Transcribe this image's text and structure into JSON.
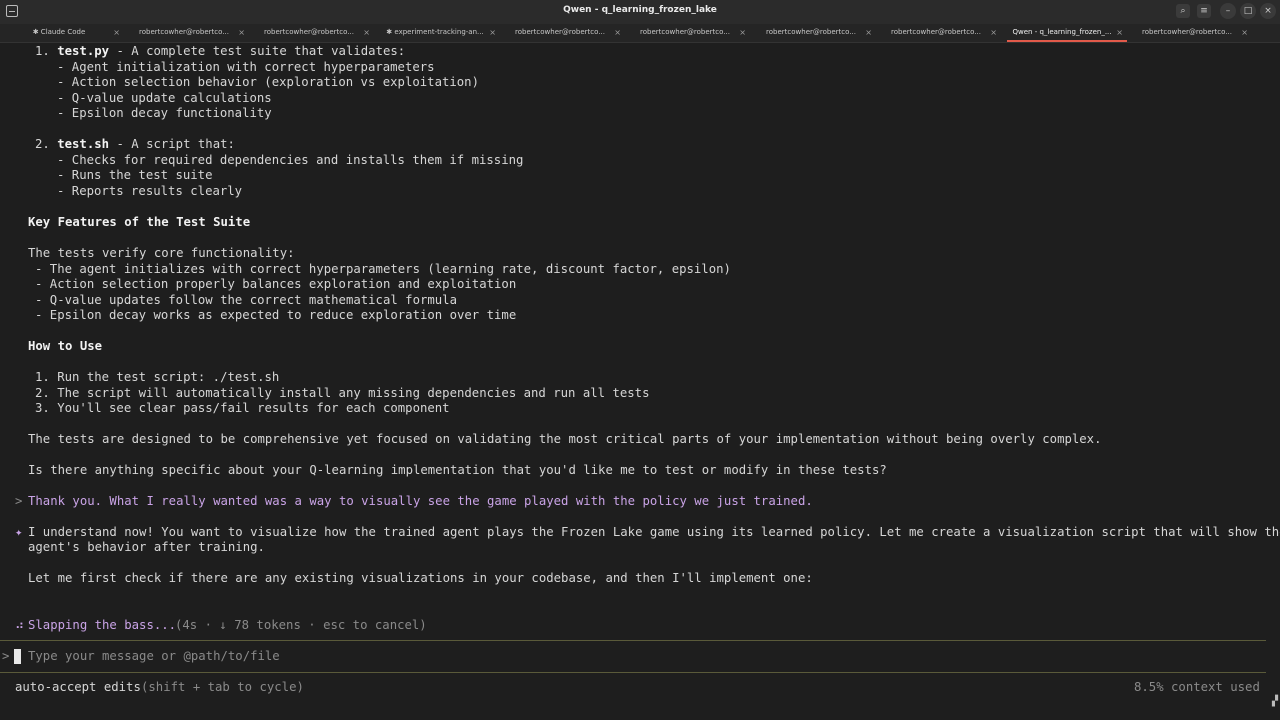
{
  "window": {
    "title": "Qwen - q_learning_frozen_lake"
  },
  "tabs": [
    {
      "label": "✱ Claude Code",
      "active": false
    },
    {
      "label": "robertcowher@robertco...",
      "active": false
    },
    {
      "label": "robertcowher@robertco...",
      "active": false
    },
    {
      "label": "✱ experiment-tracking-an...",
      "active": false
    },
    {
      "label": "robertcowher@robertco...",
      "active": false
    },
    {
      "label": "robertcowher@robertco...",
      "active": false
    },
    {
      "label": "robertcowher@robertco...",
      "active": false
    },
    {
      "label": "robertcowher@robertco...",
      "active": false
    },
    {
      "label": "Qwen - q_learning_frozen_...",
      "active": true
    },
    {
      "label": "robertcowher@robertco...",
      "active": false
    }
  ],
  "tab_close_glyph": "×",
  "content": {
    "l1_num": "1. ",
    "l1_bold": "test.py",
    "l1_rest": " - A complete test suite that validates:",
    "l2": "- Agent initialization with correct hyperparameters",
    "l3": "- Action selection behavior (exploration vs exploitation)",
    "l4": "- Q-value update calculations",
    "l5": "- Epsilon decay functionality",
    "l6_num": "2. ",
    "l6_bold": "test.sh",
    "l6_rest": " - A script that:",
    "l7": "- Checks for required dependencies and installs them if missing",
    "l8": "- Runs the test suite",
    "l9": "- Reports results clearly",
    "h1": "Key Features of the Test Suite",
    "p1": "The tests verify core functionality:",
    "f1": "- The agent initializes with correct hyperparameters (learning rate, discount factor, epsilon)",
    "f2": "- Action selection properly balances exploration and exploitation",
    "f3": "- Q-value updates follow the correct mathematical formula",
    "f4": "- Epsilon decay works as expected to reduce exploration over time",
    "h2": "How to Use",
    "u1": "1. Run the test script: ./test.sh",
    "u2": "2. The script will automatically install any missing dependencies and run all tests",
    "u3": "3. You'll see clear pass/fail results for each component",
    "p2": "The tests are designed to be comprehensive yet focused on validating the most critical parts of your implementation without being overly complex.",
    "p3": "Is there anything specific about your Q-learning implementation that you'd like me to test or modify in these tests?",
    "user_prompt_marker": ">",
    "user_msg": "Thank you. What I really wanted was a way to visually see the game played with the policy we just trained.",
    "assistant_marker": "✦",
    "a1": "I understand now! You want to visualize how the trained agent plays the Frozen Lake game using its learned policy. Let me create a visualization script that will show the",
    "a2": "agent's behavior after training.",
    "a3": "Let me first check if there are any existing visualizations in your codebase, and then I'll implement one:"
  },
  "status": {
    "spinner_glyph": "⠴",
    "loading_text": "Slapping the bass...",
    "loading_meta": "(4s · ↓ 78 tokens · esc to cancel)"
  },
  "input": {
    "prompt": ">",
    "placeholder": "Type your message or @path/to/file"
  },
  "footer": {
    "mode": "auto-accept edits",
    "mode_hint": "(shift + tab to cycle)",
    "context": "8.5% context used"
  },
  "colors": {
    "background": "#1e1e1e",
    "accent_purple": "#c9a3e6",
    "active_tab_underline": "#e25a4a"
  }
}
